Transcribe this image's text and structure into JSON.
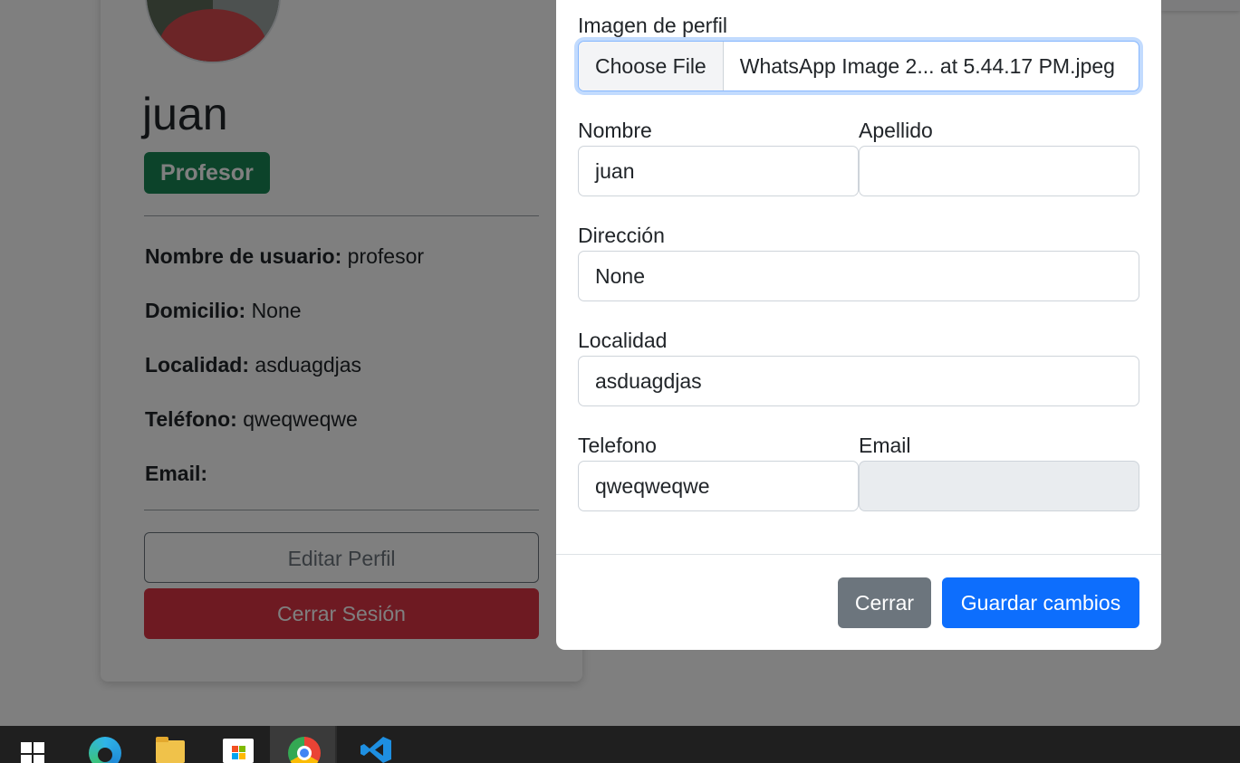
{
  "profile": {
    "name": "juan",
    "role_badge": "Profesor",
    "username_label": "Nombre de usuario:",
    "username_value": "profesor",
    "address_label": "Domicilio:",
    "address_value": "None",
    "locality_label": "Localidad:",
    "locality_value": "asduagdjas",
    "phone_label": "Teléfono:",
    "phone_value": "qweqweqwe",
    "email_label": "Email:",
    "email_value": "",
    "edit_button": "Editar Perfil",
    "logout_button": "Cerrar Sesión"
  },
  "modal": {
    "image_label": "Imagen de perfil",
    "file_button": "Choose File",
    "file_name": "WhatsApp Image 2... at 5.44.17 PM.jpeg",
    "first_name_label": "Nombre",
    "first_name_value": "juan",
    "last_name_label": "Apellido",
    "last_name_value": "",
    "address_label": "Dirección",
    "address_value": "None",
    "locality_label": "Localidad",
    "locality_value": "asduagdjas",
    "phone_label": "Telefono",
    "phone_value": "qweqweqwe",
    "email_label": "Email",
    "email_value": "",
    "close_button": "Cerrar",
    "save_button": "Guardar cambios"
  },
  "taskbar": {
    "icons": [
      "windows-start-icon",
      "edge-icon",
      "file-explorer-icon",
      "microsoft-store-icon",
      "chrome-icon",
      "vscode-icon"
    ],
    "active_app": "chrome-icon"
  },
  "colors": {
    "badge": "#198754",
    "danger": "#dc3545",
    "primary": "#0d6efd",
    "secondary": "#6c757d",
    "backdrop": "rgba(0,0,0,0.5)",
    "taskbar": "#1f1f1f"
  }
}
